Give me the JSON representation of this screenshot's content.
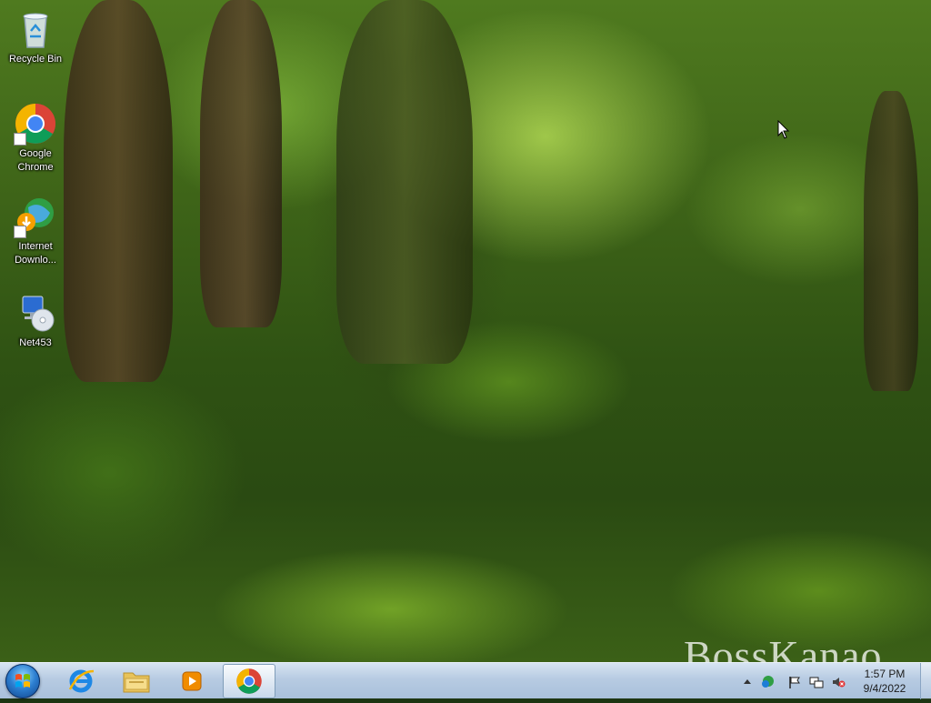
{
  "desktop": {
    "icons": [
      {
        "label": "Recycle Bin",
        "icon": "recycle-bin-icon"
      },
      {
        "label": "Google Chrome",
        "icon": "chrome-icon"
      },
      {
        "label": "Internet Downlo...",
        "icon": "internet-download-manager-icon"
      },
      {
        "label": "Net453",
        "icon": "net453-installer-icon"
      }
    ],
    "watermark": "BossKanao"
  },
  "taskbar": {
    "start": {
      "icon": "windows-start-orb-icon"
    },
    "pinned": [
      {
        "name": "Internet Explorer",
        "icon": "internet-explorer-icon"
      },
      {
        "name": "Windows Explorer",
        "icon": "folder-icon"
      },
      {
        "name": "Windows Media Player",
        "icon": "media-player-icon"
      },
      {
        "name": "Google Chrome",
        "icon": "chrome-icon",
        "active": true
      }
    ],
    "tray": {
      "icons": [
        "show-hidden-icons-arrow",
        "idm-tray-icon",
        "action-center-flag-icon",
        "network-icon",
        "volume-muted-icon"
      ],
      "time": "1:57 PM",
      "date": "9/4/2022"
    }
  },
  "colors": {
    "taskbar": "#b7cbe2",
    "label_text": "#ffffff",
    "wallpaper_base": "#3e6418"
  }
}
